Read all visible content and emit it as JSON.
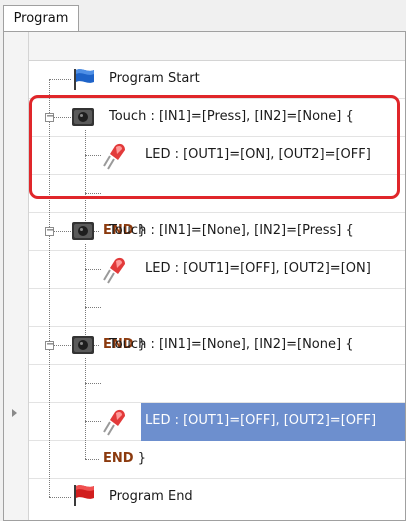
{
  "tab": {
    "label": "Program"
  },
  "rows": [
    {
      "text": "Program Start"
    },
    {
      "text": "Touch : [IN1]=[Press], [IN2]=[None] {"
    },
    {
      "text": "LED : [OUT1]=[ON], [OUT2]=[OFF]"
    },
    {
      "end": "END",
      "brace": "}"
    },
    {
      "text": "Touch : [IN1]=[None], [IN2]=[Press] {"
    },
    {
      "text": "LED : [OUT1]=[OFF], [OUT2]=[ON]"
    },
    {
      "end": "END",
      "brace": "}"
    },
    {
      "text": "Touch : [IN1]=[None], [IN2]=[None] {"
    },
    {
      "text": "LED : [OUT1]=[OFF], [OUT2]=[OFF]"
    },
    {
      "end": "END",
      "brace": "}"
    },
    {
      "text": "Program End"
    }
  ],
  "expander_symbol": "−",
  "colors": {
    "selection": "#6d8fce",
    "highlight_box": "#e0262a",
    "end_keyword": "#8b3a0e"
  },
  "icons": [
    "blue-flag-icon",
    "touch-sensor-icon",
    "red-led-icon",
    "red-flag-icon"
  ]
}
